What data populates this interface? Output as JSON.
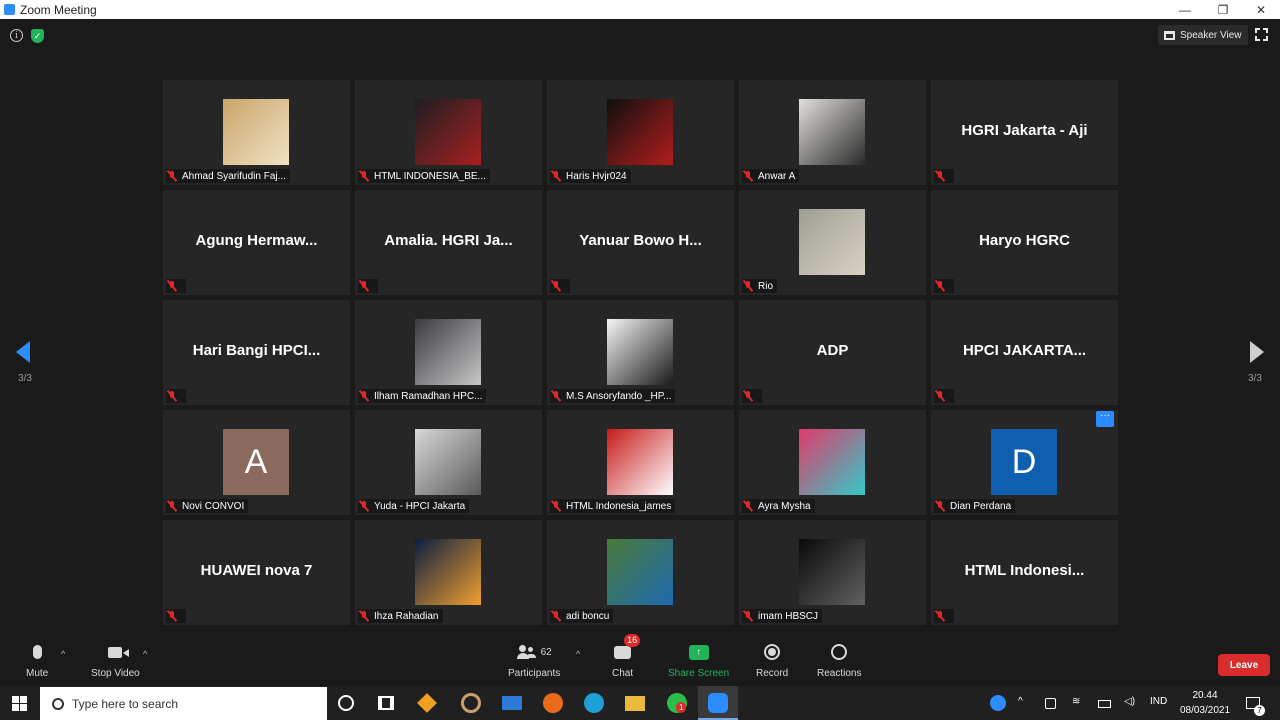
{
  "window": {
    "title": "Zoom Meeting",
    "minimize": "—",
    "restore": "❐",
    "close": "✕"
  },
  "top_bar": {
    "speaker_view_label": "Speaker View"
  },
  "pager": {
    "left_label": "3/3",
    "right_label": "3/3"
  },
  "participants": [
    {
      "name": "Ahmad Syarifudin Faj...",
      "type": "video",
      "thumb": [
        "#c9a56a",
        "#f0e2c4"
      ]
    },
    {
      "name": "HTML INDONESIA_BE...",
      "type": "video",
      "thumb": [
        "#1e1e24",
        "#a82020"
      ]
    },
    {
      "name": "Haris Hvjr024",
      "type": "video",
      "thumb": [
        "#101010",
        "#b31d1d"
      ]
    },
    {
      "name": "Anwar A",
      "type": "video",
      "thumb": [
        "#e2e0dc",
        "#2a2a2a"
      ]
    },
    {
      "name": "HGRI Jakarta - Aji",
      "type": "name"
    },
    {
      "name": "Agung  Hermaw...",
      "type": "name"
    },
    {
      "name": "Amalia.  HGRI  Ja...",
      "type": "name"
    },
    {
      "name": "Yanuar Bowo H...",
      "type": "name"
    },
    {
      "name": "Rio",
      "type": "video",
      "thumb": [
        "#9e9e96",
        "#d9d2c4"
      ]
    },
    {
      "name": "Haryo HGRC",
      "type": "name"
    },
    {
      "name": "Hari Bangi HPCI...",
      "type": "name"
    },
    {
      "name": "Ilham Ramadhan HPC...",
      "type": "video",
      "thumb": [
        "#3a3a40",
        "#c8c8c8"
      ]
    },
    {
      "name": "M.S Ansoryfando _HP...",
      "type": "video",
      "thumb": [
        "#f5f5f5",
        "#1a1a1a"
      ]
    },
    {
      "name": "ADP",
      "type": "name"
    },
    {
      "name": "HPCI  JAKARTA...",
      "type": "name"
    },
    {
      "name": "Novi CONVOI",
      "type": "letter",
      "letter": "A",
      "color": "#8a6a5c"
    },
    {
      "name": "Yuda - HPCI Jakarta",
      "type": "video",
      "thumb": [
        "#d8d8d8",
        "#5a5a5a"
      ]
    },
    {
      "name": "HTML Indonesia_james",
      "type": "video",
      "thumb": [
        "#c61a1a",
        "#ffffff"
      ]
    },
    {
      "name": "Ayra Mysha",
      "type": "video",
      "thumb": [
        "#e23a6a",
        "#34c8c8"
      ]
    },
    {
      "name": "Dian Perdana",
      "type": "letter",
      "letter": "D",
      "color": "#0f5fb0"
    },
    {
      "name": "HUAWEI nova 7",
      "type": "name"
    },
    {
      "name": "Ihza Rahadian",
      "type": "video",
      "thumb": [
        "#0d1e40",
        "#f0a030"
      ]
    },
    {
      "name": "adi boncu",
      "type": "video",
      "thumb": [
        "#4a7a3a",
        "#1e6ab0"
      ]
    },
    {
      "name": "imam HBSCJ",
      "type": "video",
      "thumb": [
        "#0a0a0a",
        "#606060"
      ]
    },
    {
      "name": "HTML  Indonesi...",
      "type": "name"
    }
  ],
  "toolbar": {
    "mute_label": "Mute",
    "stop_video_label": "Stop Video",
    "participants_label": "Participants",
    "participants_count": "62",
    "chat_label": "Chat",
    "chat_badge": "16",
    "share_label": "Share Screen",
    "record_label": "Record",
    "reactions_label": "Reactions",
    "leave_label": "Leave",
    "caret": "^"
  },
  "taskbar": {
    "search_placeholder": "Type here to search",
    "lang": "IND",
    "time": "20.44",
    "date": "08/03/2021",
    "notif_count": "7",
    "whatsapp_badge": "1"
  },
  "colors": {
    "accent": "#2d8cff",
    "leave": "#d92c2c",
    "share": "#23b45a",
    "muted": "#e02828"
  }
}
